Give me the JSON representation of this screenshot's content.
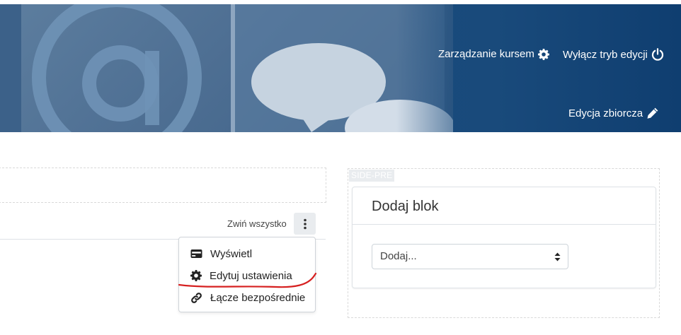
{
  "header": {
    "course_admin_label": "Zarządzanie kursem",
    "course_admin_icon": "gear-icon",
    "edit_mode_off_label": "Wyłącz tryb edycji",
    "edit_mode_off_icon": "power-icon",
    "bulk_edit_label": "Edycja zbiorcza",
    "bulk_edit_icon": "pencil-icon"
  },
  "section": {
    "collapse_all_label": "Zwiń wszystko",
    "actions_icon": "kebab-icon",
    "menu": {
      "items": [
        {
          "label": "Wyświetl",
          "icon": "card-icon"
        },
        {
          "label": "Edytuj ustawienia",
          "icon": "gear-icon"
        },
        {
          "label": "Łącze bezpośrednie",
          "icon": "link-icon"
        }
      ]
    }
  },
  "side_pre": {
    "region_label": "SIDE-PRE",
    "block_title": "Dodaj blok",
    "select_value": "Dodaj..."
  },
  "colors": {
    "banner": "#184a7c",
    "annotation": "#d62020"
  }
}
